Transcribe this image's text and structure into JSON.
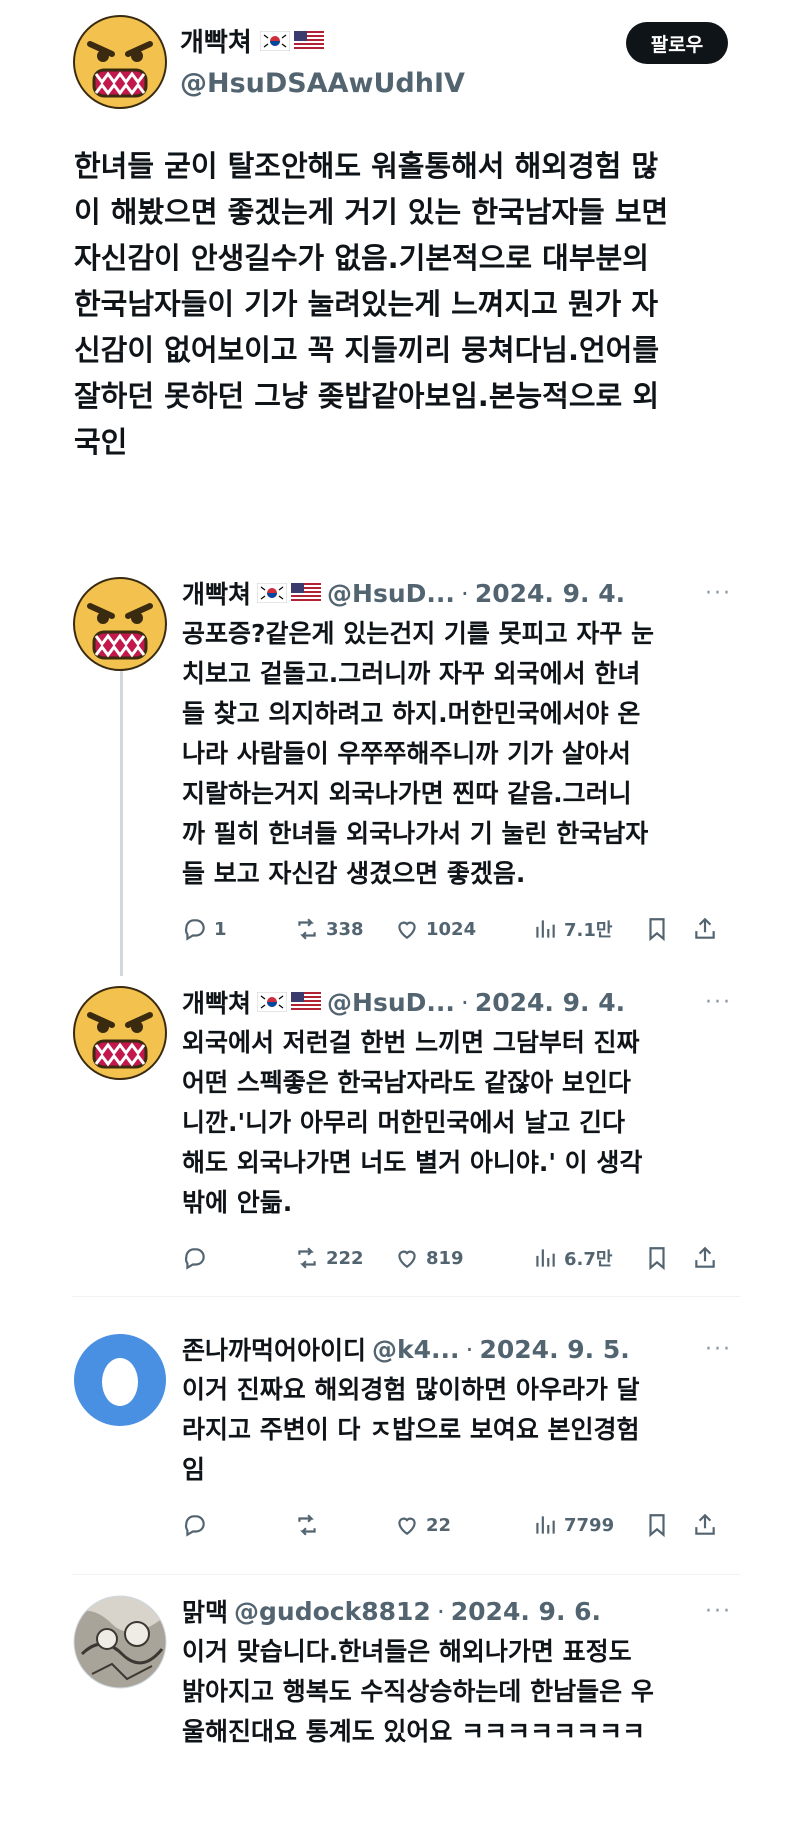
{
  "main": {
    "name": "개빡쳐",
    "handle": "@HsuDSAAwUdhIV",
    "follow_label": "팔로우",
    "text": "한녀들 굳이 탈조안해도 워홀통해서 해외경험 많\n이 해봤으면 좋겠는게 거기 있는 한국남자들 보면\n자신감이 안생길수가 없음.기본적으로 대부분의\n한국남자들이 기가 눌려있는게 느껴지고 뭔가 자\n신감이 없어보이고 꼭 지들끼리 뭉쳐다님.언어를\n잘하던 못하던 그냥 좆밥같아보임.본능적으로 외\n국인"
  },
  "replies": [
    {
      "name": "개빡쳐",
      "handle": "@HsuD...",
      "date": "2024. 9. 4.",
      "text": "공포증?같은게 있는건지 기를 못피고 자꾸 눈\n치보고 겉돌고.그러니까 자꾸 외국에서 한녀\n들 찾고 의지하려고 하지.머한민국에서야 온\n나라 사람들이 우쭈쭈해주니까 기가 살아서\n지랄하는거지 외국나가면 찐따 같음.그러니\n까 필히 한녀들 외국나가서 기 눌린 한국남자\n들 보고 자신감 생겼으면 좋겠음.",
      "replies": "1",
      "retweets": "338",
      "likes": "1024",
      "views": "7.1만"
    },
    {
      "name": "개빡쳐",
      "handle": "@HsuD...",
      "date": "2024. 9. 4.",
      "text": "외국에서 저런걸 한번 느끼면 그담부터 진짜\n어떤 스펙좋은 한국남자라도 같잖아 보인다\n니깐.'니가 아무리 머한민국에서 날고 긴다\n해도 외국나가면 너도 별거 아니야.' 이 생각\n밖에 안듦.",
      "replies": "",
      "retweets": "222",
      "likes": "819",
      "views": "6.7만"
    },
    {
      "name": "존나까먹어아이디",
      "handle": "@k4...",
      "date": "2024. 9. 5.",
      "text": "이거 진짜요 해외경험 많이하면 아우라가 달\n라지고 주변이 다 ㅈ밥으로 보여요 본인경험\n임",
      "replies": "",
      "retweets": "",
      "likes": "22",
      "views": "7799"
    },
    {
      "name": "맑맥",
      "handle": "@gudock8812",
      "date": "2024. 9. 6.",
      "text": "이거 맞습니다.한녀들은 해외나가면 표정도\n밝아지고 행복도 수직상승하는데 한남들은 우\n울해진대요 통계도 있어요 ㅋㅋㅋㅋㅋㅋㅋㅋ"
    }
  ],
  "dot": "·",
  "more": "···",
  "colors": {
    "text": "#0f1419",
    "secondary": "#536471",
    "divider": "#eff3f4",
    "angry_face": "#f2c14e"
  }
}
